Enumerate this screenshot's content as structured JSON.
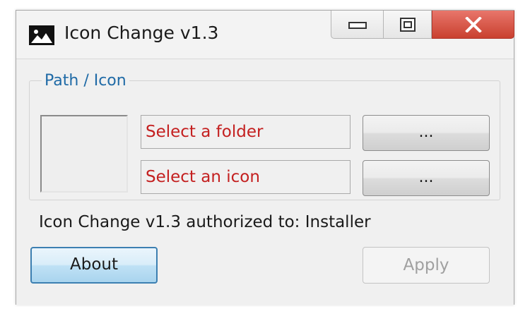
{
  "window": {
    "title": "Icon Change v1.3",
    "app_icon": "image-icon",
    "caption_buttons": [
      "minimize-icon",
      "maximize-icon",
      "close-icon"
    ],
    "close_color": "#c9402f"
  },
  "group": {
    "title": "Path / Icon",
    "title_color": "#1f6aa6"
  },
  "fields": {
    "folder_placeholder": "Select a folder",
    "icon_placeholder": "Select an icon",
    "text_color": "#c42020"
  },
  "buttons": {
    "browse_folder_label": "...",
    "browse_icon_label": "...",
    "about_label": "About",
    "apply_label": "Apply",
    "apply_enabled": false
  },
  "status": {
    "text": "Icon Change v1.3 authorized to:  Installer"
  }
}
